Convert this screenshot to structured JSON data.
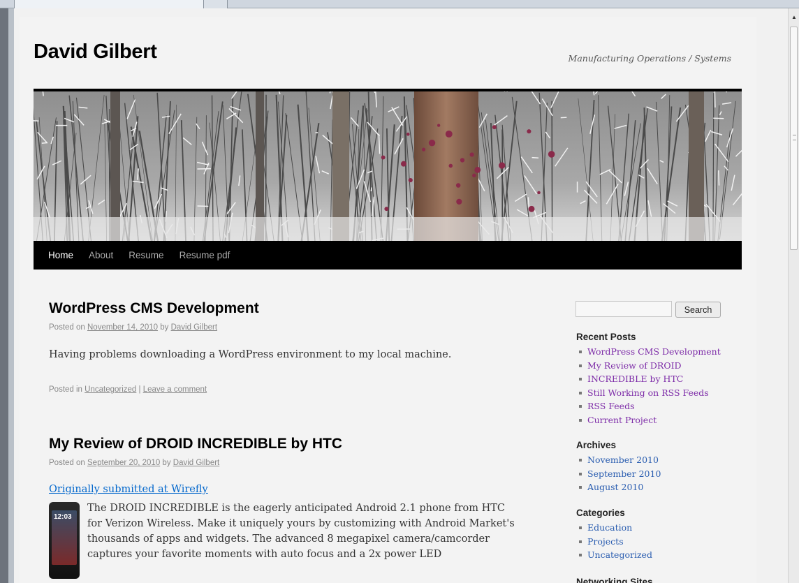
{
  "site": {
    "title": "David Gilbert",
    "description": "Manufacturing Operations / Systems"
  },
  "nav": {
    "items": [
      "Home",
      "About",
      "Resume",
      "Resume pdf"
    ]
  },
  "posts": [
    {
      "title": "WordPress CMS Development",
      "posted_on_label": "Posted on",
      "date": "November 14, 2010",
      "by_label": "by",
      "author": "David Gilbert",
      "body": "Having problems downloading a WordPress environment to my local machine.",
      "posted_in_label": "Posted in",
      "category": "Uncategorized",
      "separator": "|",
      "comment_link": "Leave a comment"
    },
    {
      "title": "My Review of DROID INCREDIBLE by HTC",
      "posted_on_label": "Posted on",
      "date": "September 20, 2010",
      "by_label": "by",
      "author": "David Gilbert",
      "link": "Originally submitted at Wirefly",
      "phone_clock": "12:03",
      "body_lines": [
        "The DROID INCREDIBLE is the eagerly anticipated Android 2.1 phone from HTC",
        "for Verizon Wireless. Make it uniquely yours by customizing with Android Market's",
        "thousands of apps and widgets. The advanced 8 megapixel camera/camcorder",
        "captures your favorite moments with auto focus and a 2x power LED"
      ]
    }
  ],
  "sidebar": {
    "search": {
      "placeholder": "",
      "button": "Search"
    },
    "recent_posts": {
      "title": "Recent Posts",
      "items": [
        "WordPress CMS Development",
        "My Review of DROID",
        "INCREDIBLE by HTC",
        "Still Working on RSS Feeds",
        "RSS Feeds",
        "Current Project"
      ]
    },
    "archives": {
      "title": "Archives",
      "items": [
        "November 2010",
        "September 2010",
        "August 2010"
      ]
    },
    "categories": {
      "title": "Categories",
      "items": [
        "Education",
        "Projects",
        "Uncategorized"
      ]
    },
    "networking": {
      "title": "Networking Sites"
    }
  },
  "colors": {
    "nav_bg": "#000000",
    "link_blue": "#0066cc",
    "visited_purple": "#7d2ca8",
    "page_bg": "#f3f3f3"
  }
}
